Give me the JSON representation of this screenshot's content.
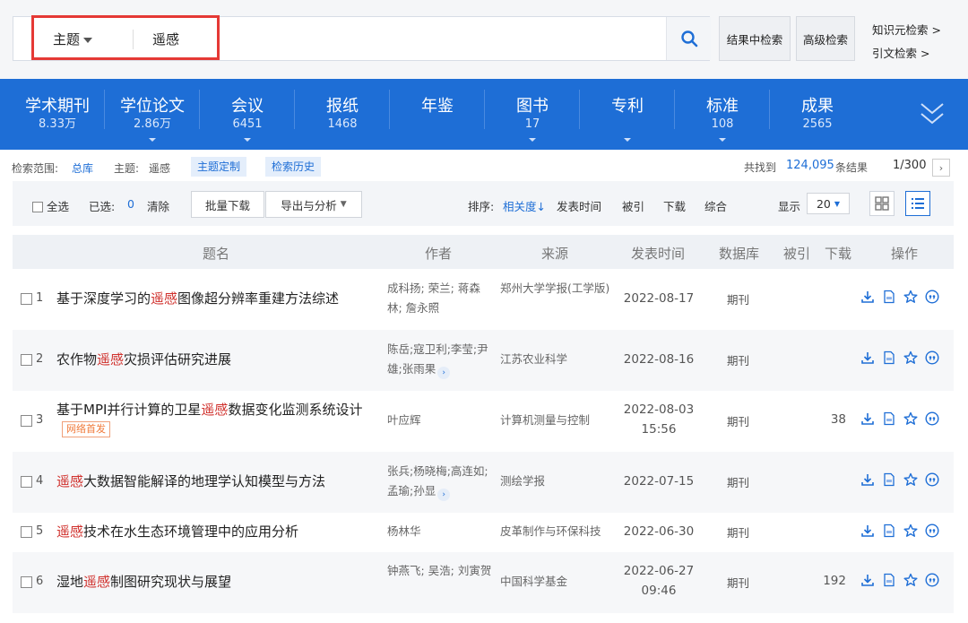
{
  "search": {
    "field": "主题",
    "query": "遥感",
    "btn_in_results": "结果中检索",
    "btn_advanced": "高级检索",
    "link_knowledge": "知识元检索 >",
    "link_citation": "引文检索 >"
  },
  "categories": [
    {
      "name": "学术期刊",
      "count": "8.33万"
    },
    {
      "name": "学位论文",
      "count": "2.86万"
    },
    {
      "name": "会议",
      "count": "6451"
    },
    {
      "name": "报纸",
      "count": "1468"
    },
    {
      "name": "年鉴",
      "count": ""
    },
    {
      "name": "图书",
      "count": "17"
    },
    {
      "name": "专利",
      "count": ""
    },
    {
      "name": "标准",
      "count": "108"
    },
    {
      "name": "成果",
      "count": "2565"
    }
  ],
  "info": {
    "scope_label": "检索范围:",
    "scope_value": "总库",
    "topic_label": "主题:",
    "topic_value": "遥感",
    "chip_custom": "主题定制",
    "chip_history": "检索历史",
    "found_prefix": "共找到",
    "found_count": "124,095",
    "found_suffix": "条结果",
    "pager": "1/300"
  },
  "toolbar": {
    "select_all": "全选",
    "selected_label": "已选:",
    "selected_count": "0",
    "clear": "清除",
    "batch_download": "批量下载",
    "export": "导出与分析",
    "sort_label": "排序:",
    "sort_relevance": "相关度",
    "sort_date": "发表时间",
    "sort_cited": "被引",
    "sort_download": "下载",
    "sort_overall": "综合",
    "display_label": "显示",
    "display_value": "20"
  },
  "columns": {
    "title": "题名",
    "author": "作者",
    "source": "来源",
    "date": "发表时间",
    "db": "数据库",
    "cited": "被引",
    "download": "下载",
    "ops": "操作"
  },
  "rows": [
    {
      "num": "1",
      "pre": "基于深度学习的",
      "kw": "遥感",
      "post": "图像超分辨率重建方法综述",
      "badge": "",
      "authors": "成科扬; 荣兰; 蒋森林; 詹永照",
      "source": "郑州大学学报(工学版)",
      "date": "2022-08-17",
      "db": "期刊",
      "cited": ""
    },
    {
      "num": "2",
      "pre": "农作物",
      "kw": "遥感",
      "post": "灾损评估研究进展",
      "badge": "",
      "authors": "陈岳;寇卫利;李莹;尹雄;张雨果",
      "source": "江苏农业科学",
      "date": "2022-08-16",
      "db": "期刊",
      "cited": ""
    },
    {
      "num": "3",
      "pre": "基于MPI并行计算的卫星",
      "kw": "遥感",
      "post": "数据变化监测系统设计",
      "badge": "网络首发",
      "authors": "叶应辉",
      "source": "计算机测量与控制",
      "date": "2022-08-03 15:56",
      "db": "期刊",
      "cited": "38"
    },
    {
      "num": "4",
      "pre": "",
      "kw": "遥感",
      "post": "大数据智能解译的地理学认知模型与方法",
      "badge": "",
      "authors": "张兵;杨晓梅;高连如;孟瑜;孙显",
      "source": "测绘学报",
      "date": "2022-07-15",
      "db": "期刊",
      "cited": ""
    },
    {
      "num": "5",
      "pre": "",
      "kw": "遥感",
      "post": "技术在水生态环境管理中的应用分析",
      "badge": "",
      "authors": "杨林华",
      "source": "皮革制作与环保科技",
      "date": "2022-06-30",
      "db": "期刊",
      "cited": ""
    },
    {
      "num": "6",
      "pre": "湿地",
      "kw": "遥感",
      "post": "制图研究现状与展望",
      "badge": "",
      "authors": "钟燕飞; 吴浩; 刘寅贺",
      "source": "中国科学基金",
      "date": "2022-06-27 09:46",
      "db": "期刊",
      "cited": "192"
    }
  ]
}
